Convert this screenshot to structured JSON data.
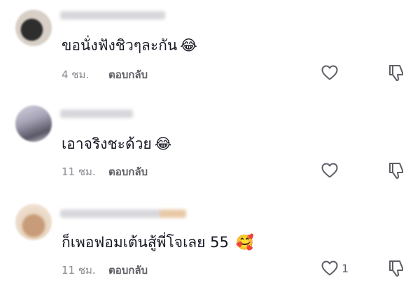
{
  "comments": [
    {
      "username_blurred": true,
      "text": "ขอนั่งฟังชิวๆละกัน",
      "emoji": "😂",
      "time": "4 ชม.",
      "reply_label": "ตอบกลับ",
      "like_count": "",
      "avatar_colors": [
        "#3a3a3a",
        "#e6e0d8"
      ]
    },
    {
      "username_blurred": true,
      "text": "เอาจริงชะด้วย",
      "emoji": "😂",
      "time": "11 ชม.",
      "reply_label": "ตอบกลับ",
      "like_count": "",
      "avatar_colors": [
        "#b9b8c8",
        "#5a5866"
      ]
    },
    {
      "username_blurred": true,
      "text": "ก็เพอฟอมเต้นสู้พี่โจเลย 55",
      "emoji": "🥰",
      "time": "11 ชม.",
      "reply_label": "ตอบกลับ",
      "like_count": "1",
      "avatar_colors": [
        "#d9b99a",
        "#f3e6d8"
      ]
    }
  ]
}
